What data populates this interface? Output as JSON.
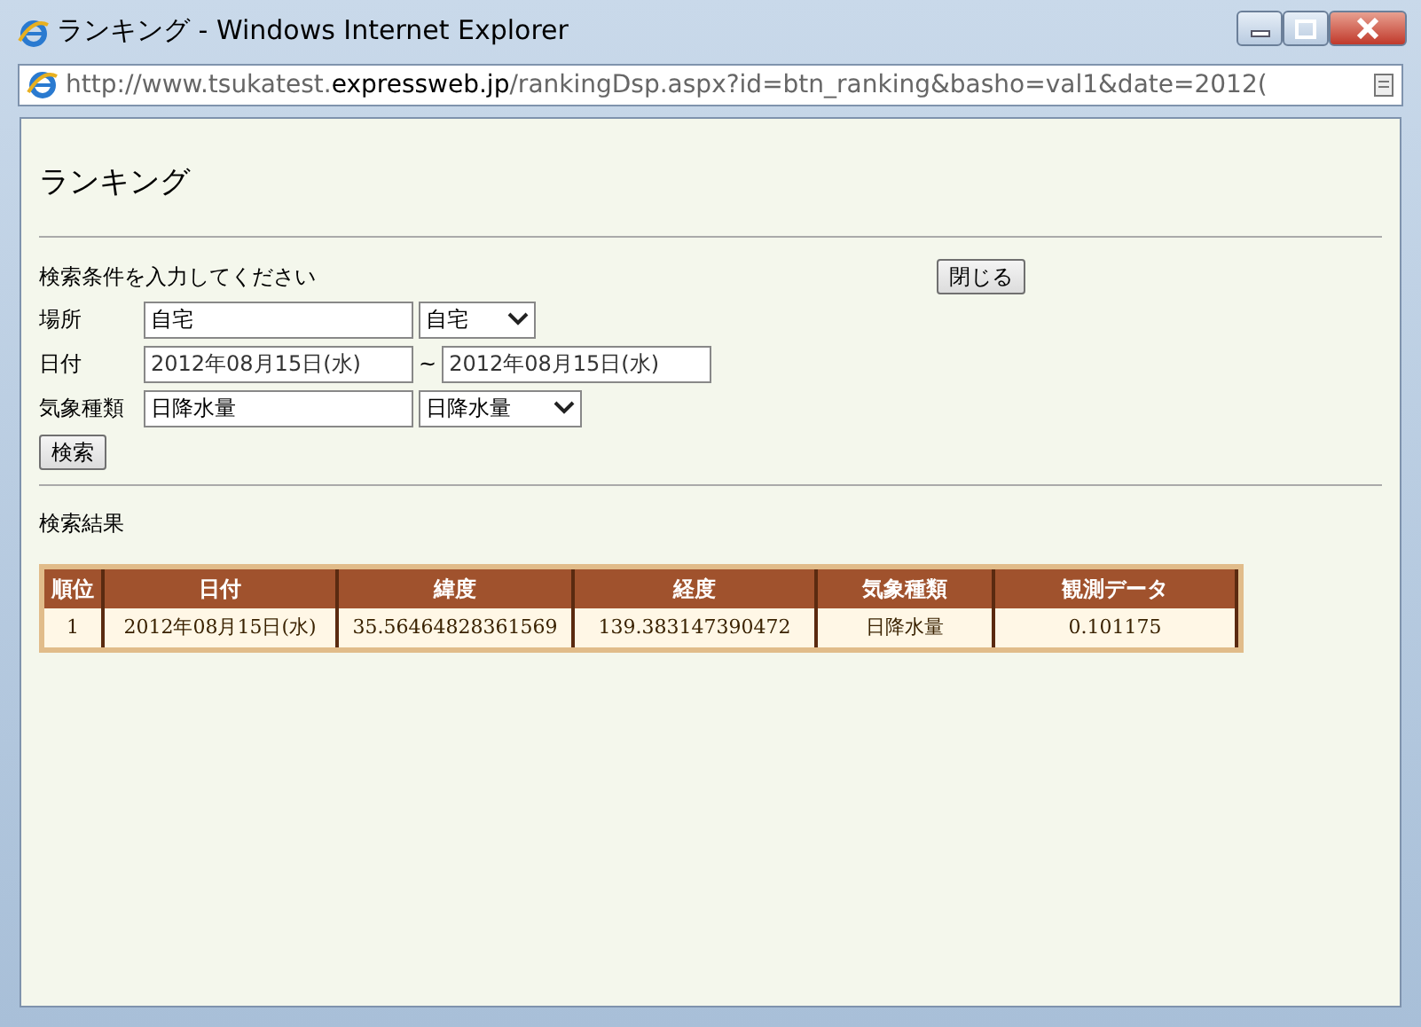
{
  "window": {
    "title": "ランキング - Windows Internet Explorer"
  },
  "address_bar": {
    "url": "http://www.tsukatest.**expressweb.jp**/rankingDsp.aspx?id=btn_ranking&basho=val1&date=2012("
  },
  "page": {
    "heading": "ランキング",
    "prompt": "検索条件を入力してください",
    "close_button": "閉じる",
    "place": {
      "label": "場所",
      "value": "自宅",
      "select": "自宅"
    },
    "date": {
      "label": "日付",
      "from": "2012年08月15日(水)",
      "separator": "~",
      "to": "2012年08月15日(水)"
    },
    "weather_type": {
      "label": "気象種類",
      "value": "日降水量",
      "select": "日降水量"
    },
    "search_button": "検索",
    "results_heading": "検索結果",
    "table": {
      "columns": [
        "順位",
        "日付",
        "緯度",
        "経度",
        "気象種類",
        "観測データ"
      ],
      "rows": [
        [
          "1",
          "2012年08月15日(水)",
          "35.56464828361569",
          "139.383147390472",
          "日降水量",
          "0.101175"
        ]
      ]
    }
  }
}
